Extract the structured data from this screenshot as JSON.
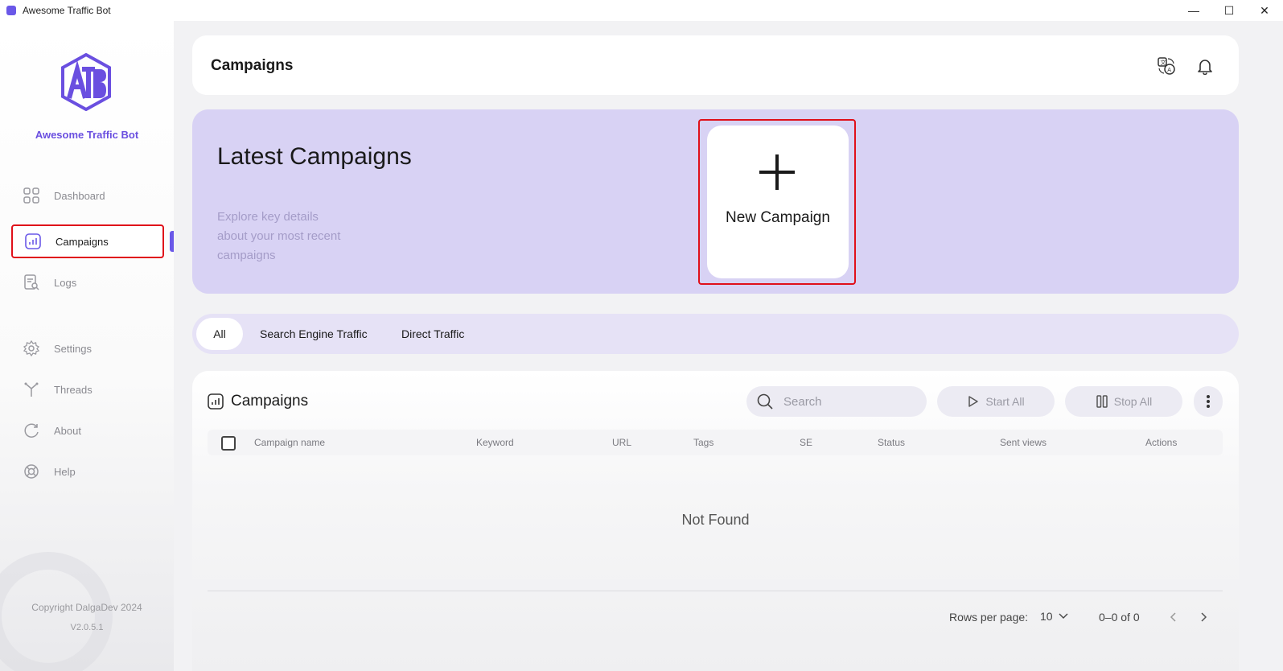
{
  "window": {
    "title": "Awesome Traffic Bot",
    "controls": {
      "minimize": "—",
      "maximize": "☐",
      "close": "✕"
    }
  },
  "sidebar": {
    "brand": "Awesome Traffic Bot",
    "logo_icon": "atb-logo-icon",
    "items": [
      {
        "label": "Dashboard",
        "icon": "dashboard-grid-icon"
      },
      {
        "label": "Campaigns",
        "icon": "chart-box-icon",
        "active": true
      },
      {
        "label": "Logs",
        "icon": "log-search-icon"
      },
      {
        "label": "Settings",
        "icon": "gear-icon"
      },
      {
        "label": "Threads",
        "icon": "branch-icon"
      },
      {
        "label": "About",
        "icon": "refresh-circle-icon"
      },
      {
        "label": "Help",
        "icon": "lifebuoy-icon"
      }
    ],
    "copyright": "Copyright DalgaDev 2024",
    "version": "V2.0.5.1"
  },
  "header": {
    "title": "Campaigns",
    "icons": [
      "translate-icon",
      "bell-icon"
    ]
  },
  "banner": {
    "title": "Latest Campaigns",
    "subtitle": "Explore key details about your most recent campaigns",
    "new_campaign_label": "New Campaign"
  },
  "tabs": [
    {
      "label": "All",
      "active": true
    },
    {
      "label": "Search Engine Traffic"
    },
    {
      "label": "Direct Traffic"
    }
  ],
  "panel": {
    "title": "Campaigns",
    "search_placeholder": "Search",
    "start_all": "Start All",
    "stop_all": "Stop All",
    "columns": [
      "Campaign name",
      "Keyword",
      "URL",
      "Tags",
      "SE",
      "Status",
      "Sent views",
      "Actions"
    ],
    "empty_text": "Not Found",
    "rows_per_page_label": "Rows per page:",
    "rows_per_page_value": "10",
    "range_text": "0–0 of 0"
  },
  "colors": {
    "accent": "#6a58e8",
    "banner_bg": "#d8d2f4",
    "highlight_red": "#e0101a"
  }
}
